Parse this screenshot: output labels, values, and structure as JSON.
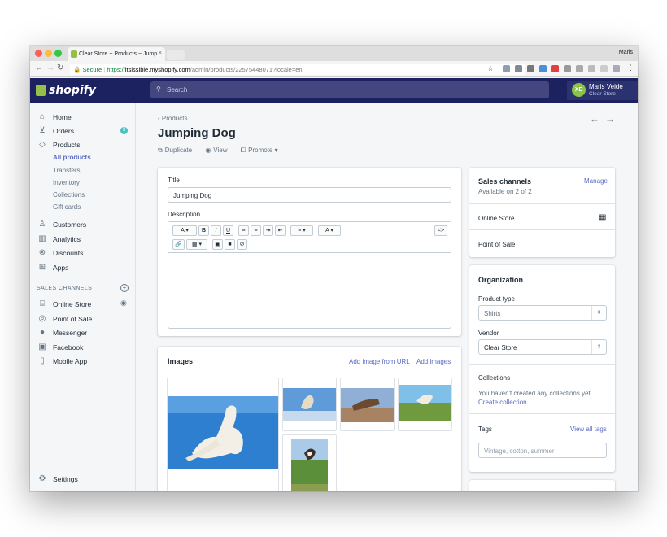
{
  "browser": {
    "tab_title": "Clear Store ~ Products ~ Jump",
    "tab_close": "×",
    "chrome_user": "Maris",
    "secure_label": "Secure",
    "url_scheme": "https://",
    "url_host": "itsissible.myshopify.com",
    "url_path": "/admin/products/22575448071?locale=en"
  },
  "topbar": {
    "brand": "shopify",
    "search_placeholder": "Search",
    "account_initials": "XE",
    "account_name": "Maris Veide",
    "account_store": "Clear Store"
  },
  "sidebar": {
    "items": [
      {
        "label": "Home"
      },
      {
        "label": "Orders",
        "badge": "3"
      },
      {
        "label": "Products"
      },
      {
        "label": "Customers"
      },
      {
        "label": "Analytics"
      },
      {
        "label": "Discounts"
      },
      {
        "label": "Apps"
      }
    ],
    "product_sub": [
      "All products",
      "Transfers",
      "Inventory",
      "Collections",
      "Gift cards"
    ],
    "sales_channels_heading": "SALES CHANNELS",
    "channels": [
      "Online Store",
      "Point of Sale",
      "Messenger",
      "Facebook",
      "Mobile App"
    ],
    "settings": "Settings"
  },
  "page": {
    "breadcrumb": "Products",
    "title": "Jumping Dog",
    "actions": [
      "Duplicate",
      "View",
      "Promote"
    ]
  },
  "form": {
    "title_label": "Title",
    "title_value": "Jumping Dog",
    "description_label": "Description",
    "toolbar_row1": [
      "A ▾",
      "B",
      "I",
      "U",
      "≡",
      "≡",
      "⇥",
      "⇤",
      "≡ ▾",
      "A ▾"
    ],
    "toolbar_code": "<>",
    "toolbar_row2": [
      "🔗",
      "▦ ▾",
      "▣",
      "■",
      "⊘"
    ]
  },
  "images": {
    "title": "Images",
    "add_from_url": "Add image from URL",
    "add_images": "Add images"
  },
  "sales_channels": {
    "title": "Sales channels",
    "manage": "Manage",
    "available": "Available on 2 of 2",
    "rows": [
      "Online Store",
      "Point of Sale"
    ]
  },
  "organization": {
    "title": "Organization",
    "product_type_label": "Product type",
    "product_type_value": "Shirts",
    "vendor_label": "Vendor",
    "vendor_value": "Clear Store",
    "collections_label": "Collections",
    "collections_empty": "You haven't created any collections yet.",
    "create_collection": "Create collection.",
    "tags_label": "Tags",
    "view_all_tags": "View all tags",
    "tags_placeholder": "Vintage, cotton, summer"
  }
}
